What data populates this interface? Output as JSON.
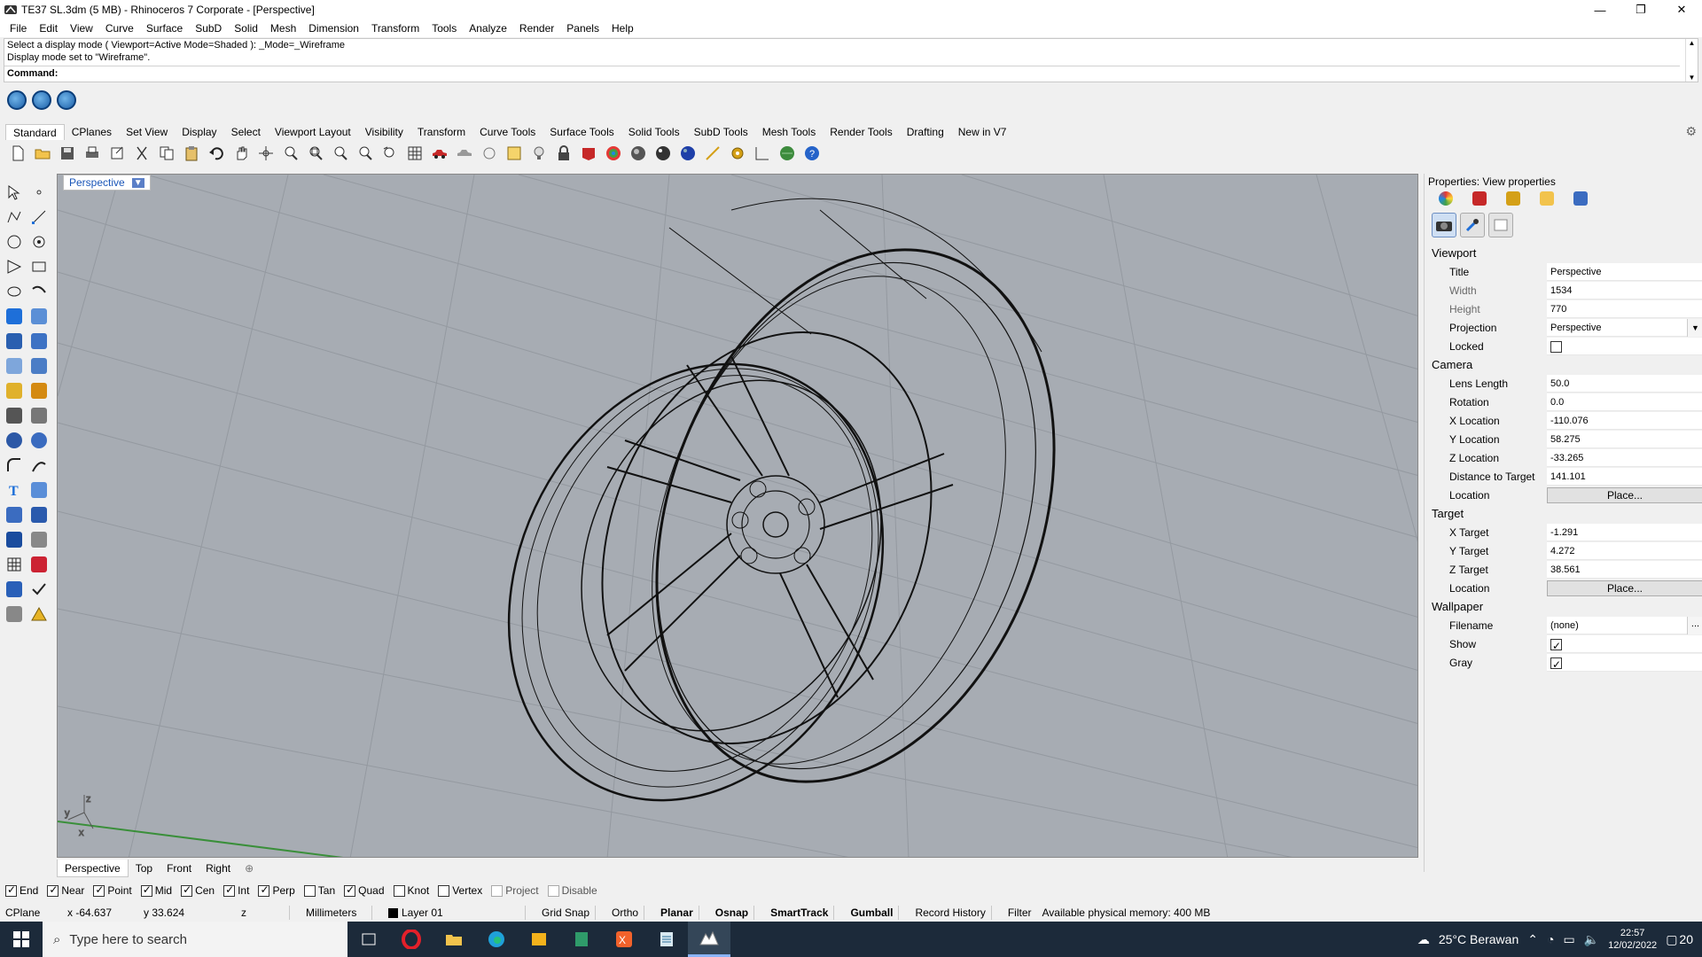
{
  "window": {
    "title": "TE37 SL.3dm (5 MB) - Rhinoceros 7 Corporate - [Perspective]",
    "controls": [
      "—",
      "❐",
      "✕"
    ]
  },
  "menu": [
    "File",
    "Edit",
    "View",
    "Curve",
    "Surface",
    "SubD",
    "Solid",
    "Mesh",
    "Dimension",
    "Transform",
    "Tools",
    "Analyze",
    "Render",
    "Panels",
    "Help"
  ],
  "command": {
    "history_line1": "Select a display mode ( Viewport=Active  Mode=Shaded ): _Mode=_Wireframe",
    "history_line2": "Display mode set to \"Wireframe\".",
    "prompt": "Command:"
  },
  "toolbar_tabs": [
    "Standard",
    "CPlanes",
    "Set View",
    "Display",
    "Select",
    "Viewport Layout",
    "Visibility",
    "Transform",
    "Curve Tools",
    "Surface Tools",
    "Solid Tools",
    "SubD Tools",
    "Mesh Tools",
    "Render Tools",
    "Drafting",
    "New in V7"
  ],
  "viewport": {
    "label": "Perspective",
    "axis_x": "x",
    "axis_y": "y",
    "axis_z": "z"
  },
  "viewport_tabs": [
    "Perspective",
    "Top",
    "Front",
    "Right"
  ],
  "properties": {
    "header": "Properties: View properties",
    "viewport_section": "Viewport",
    "title_label": "Title",
    "title_value": "Perspective",
    "width_label": "Width",
    "width_value": "1534",
    "height_label": "Height",
    "height_value": "770",
    "projection_label": "Projection",
    "projection_value": "Perspective",
    "locked_label": "Locked",
    "camera_section": "Camera",
    "lens_label": "Lens Length",
    "lens_value": "50.0",
    "rotation_label": "Rotation",
    "rotation_value": "0.0",
    "xloc_label": "X Location",
    "xloc_value": "-110.076",
    "yloc_label": "Y Location",
    "yloc_value": "58.275",
    "zloc_label": "Z Location",
    "zloc_value": "-33.265",
    "dist_label": "Distance to Target",
    "dist_value": "141.101",
    "location_label": "Location",
    "place_button": "Place...",
    "target_section": "Target",
    "xt_label": "X Target",
    "xt_value": "-1.291",
    "yt_label": "Y Target",
    "yt_value": "4.272",
    "zt_label": "Z Target",
    "zt_value": "38.561",
    "location2_label": "Location",
    "place_button2": "Place...",
    "wallpaper_section": "Wallpaper",
    "filename_label": "Filename",
    "filename_value": "(none)",
    "filename_button": "...",
    "show_label": "Show",
    "gray_label": "Gray"
  },
  "osnaps": [
    {
      "label": "End",
      "checked": true
    },
    {
      "label": "Near",
      "checked": true
    },
    {
      "label": "Point",
      "checked": true
    },
    {
      "label": "Mid",
      "checked": true
    },
    {
      "label": "Cen",
      "checked": true
    },
    {
      "label": "Int",
      "checked": true
    },
    {
      "label": "Perp",
      "checked": true
    },
    {
      "label": "Tan",
      "checked": false
    },
    {
      "label": "Quad",
      "checked": true
    },
    {
      "label": "Knot",
      "checked": false
    },
    {
      "label": "Vertex",
      "checked": false
    },
    {
      "label": "Project",
      "checked": false
    },
    {
      "label": "Disable",
      "checked": false
    }
  ],
  "status": {
    "cplane": "CPlane",
    "x": "x -64.637",
    "y": "y 33.624",
    "z": "z",
    "units": "Millimeters",
    "layer": "Layer 01",
    "grid_snap": "Grid Snap",
    "ortho": "Ortho",
    "planar": "Planar",
    "osnap": "Osnap",
    "smarttrack": "SmartTrack",
    "gumball": "Gumball",
    "record_history": "Record History",
    "filter": "Filter",
    "memory": "Available physical memory: 400 MB"
  },
  "taskbar": {
    "search_placeholder": "Type here to search",
    "weather": "25°C  Berawan",
    "time": "22:57",
    "date": "12/02/2022",
    "notifications": "20"
  }
}
